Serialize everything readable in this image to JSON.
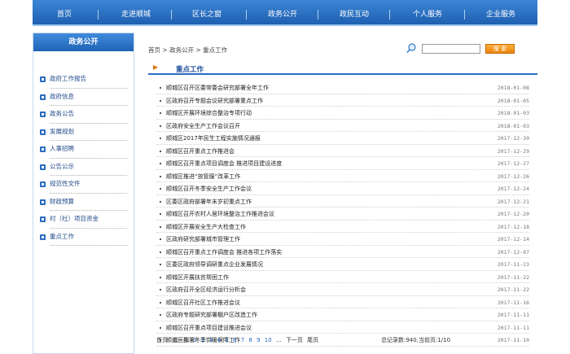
{
  "nav": {
    "items": [
      "首页",
      "走进顺城",
      "区长之窗",
      "政务公开",
      "政民互动",
      "个人服务",
      "企业服务"
    ]
  },
  "sidebar": {
    "header": "政务公开",
    "items": [
      "政府工作报告",
      "政府信息",
      "政务公告",
      "发展规划",
      "人事招聘",
      "公告公示",
      "规范性文件",
      "财政预算",
      "村（社）项目资金",
      "重点工作"
    ]
  },
  "breadcrumb": {
    "home": "首页",
    "sep1": ">",
    "level1": "政务公开",
    "sep2": ">",
    "current": "重点工作"
  },
  "search": {
    "placeholder": "",
    "button": "搜 索"
  },
  "section": {
    "title": "重点工作"
  },
  "news": [
    {
      "title": "顺城区召开区委常委会研究部署全年工作",
      "date": "2018-01-08"
    },
    {
      "title": "区政府召开专题会议研究部署重点工作",
      "date": "2018-01-05"
    },
    {
      "title": "顺城区开展环境综合整治专项行动",
      "date": "2018-01-03"
    },
    {
      "title": "区政府安全生产工作会议召开",
      "date": "2018-01-03"
    },
    {
      "title": "顺城区2017年民生工程实施情况通报",
      "date": "2017-12-30"
    },
    {
      "title": "顺城区召开重点工作推进会",
      "date": "2017-12-29"
    },
    {
      "title": "顺城区召开重点项目调度会 推进项目建设进度",
      "date": "2017-12-27"
    },
    {
      "title": "顺城区推进“放管服”改革工作",
      "date": "2017-12-26"
    },
    {
      "title": "顺城区召开冬季安全生产工作会议",
      "date": "2017-12-24"
    },
    {
      "title": "区委区政府部署年末岁初重点工作",
      "date": "2017-12-21"
    },
    {
      "title": "顺城区召开农村人居环境整治工作推进会议",
      "date": "2017-12-20"
    },
    {
      "title": "顺城区开展安全生产大检查工作",
      "date": "2017-12-18"
    },
    {
      "title": "区政府研究部署城市管理工作",
      "date": "2017-12-14"
    },
    {
      "title": "顺城区召开重点工作调度会 推进各项工作落实",
      "date": "2017-12-07"
    },
    {
      "title": "区委区政府领导调研重点企业发展情况",
      "date": "2017-11-23"
    },
    {
      "title": "顺城区开展扶贫帮困工作",
      "date": "2017-11-22"
    },
    {
      "title": "区政府召开全区经济运行分析会",
      "date": "2017-11-22"
    },
    {
      "title": "顺城区召开社区工作推进会议",
      "date": "2017-11-16"
    },
    {
      "title": "区政府专题研究部署棚户区改造工作",
      "date": "2017-11-11"
    },
    {
      "title": "顺城区召开重点项目建设推进会议",
      "date": "2017-11-11"
    },
    {
      "title": "顺城区部署冬季供暖保障工作",
      "date": "2017-11-10"
    }
  ],
  "pager": {
    "first": "首页",
    "prev": "上一页",
    "pages": [
      "1",
      "2",
      "3",
      "4",
      "5",
      "6",
      "7",
      "8",
      "9",
      "10"
    ],
    "ellipsis": "...",
    "next": "下一页",
    "last": "尾页",
    "summary": "总记录数:940,当前页:1/10"
  }
}
